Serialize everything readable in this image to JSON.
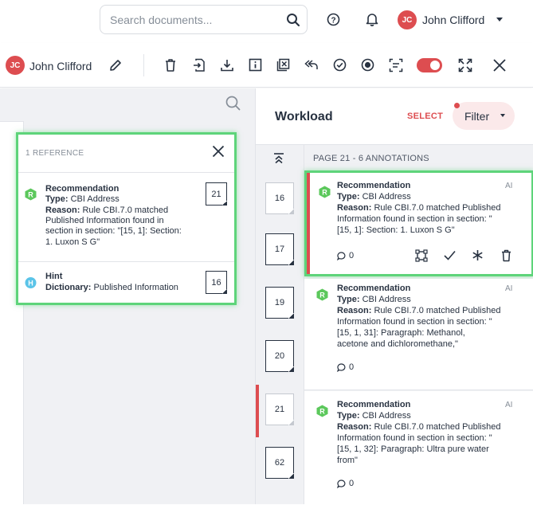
{
  "header": {
    "search_placeholder": "Search documents...",
    "user": {
      "initials": "JC",
      "name": "John Clifford"
    }
  },
  "toolbar": {
    "user": {
      "initials": "JC",
      "name": "John Clifford"
    },
    "icons": [
      "edit-icon",
      "delete-icon",
      "export-icon",
      "download-icon",
      "info-icon",
      "exclude-pages-icon",
      "undo-icon",
      "check-circle-icon",
      "record-icon",
      "scan-icon",
      "toggle",
      "fullscreen-icon",
      "close-icon"
    ]
  },
  "popup": {
    "title": "1 REFERENCE",
    "items": [
      {
        "badge": "R",
        "title": "Recommendation",
        "type_label": "Type:",
        "type_value": "CBI Address",
        "reason_label": "Reason:",
        "reason_lines": [
          "Rule CBI.7.0 matched",
          "Published Information found in",
          "section in section: \"[15, 1]: Section:",
          "1. Luxon S G\""
        ],
        "page": "21"
      },
      {
        "badge": "H",
        "title": "Hint",
        "dict_label": "Dictionary:",
        "dict_value": "Published Information",
        "page": "16"
      }
    ]
  },
  "workload": {
    "title": "Workload",
    "select_label": "SELECT",
    "filter_label": "Filter",
    "page_label": "PAGE 21 - 6 ANNOTATIONS",
    "pages": [
      "16",
      "17",
      "19",
      "20",
      "21",
      "62"
    ],
    "annotations": [
      {
        "badge": "R",
        "title": "Recommendation",
        "ai": "AI",
        "type_label": "Type:",
        "type_value": "CBI Address",
        "reason_label": "Reason:",
        "reason_lines": [
          "Rule CBI.7.0 matched Published",
          "Information found in section in section: \"",
          "[15, 1]: Section: 1. Luxon S G\""
        ],
        "comments": "0"
      },
      {
        "badge": "R",
        "title": "Recommendation",
        "ai": "AI",
        "type_label": "Type:",
        "type_value": "CBI Address",
        "reason_label": "Reason:",
        "reason_lines": [
          "Rule CBI.7.0 matched Published",
          "Information found in section in section: \"",
          "[15, 1, 31]: Paragraph: Methanol,",
          "acetone and dichloromethane,\""
        ],
        "comments": "0"
      },
      {
        "badge": "R",
        "title": "Recommendation",
        "ai": "AI",
        "type_label": "Type:",
        "type_value": "CBI Address",
        "reason_label": "Reason:",
        "reason_lines": [
          "Rule CBI.7.0 matched Published",
          "Information found in section in section: \"",
          "[15, 1, 32]: Paragraph: Ultra pure water",
          "from\""
        ],
        "comments": "0"
      }
    ]
  },
  "colors": {
    "accent": "#dd4d50",
    "highlight": "#5ed47a",
    "recommendation": "#5cc85c",
    "hint": "#5bc4e8"
  }
}
